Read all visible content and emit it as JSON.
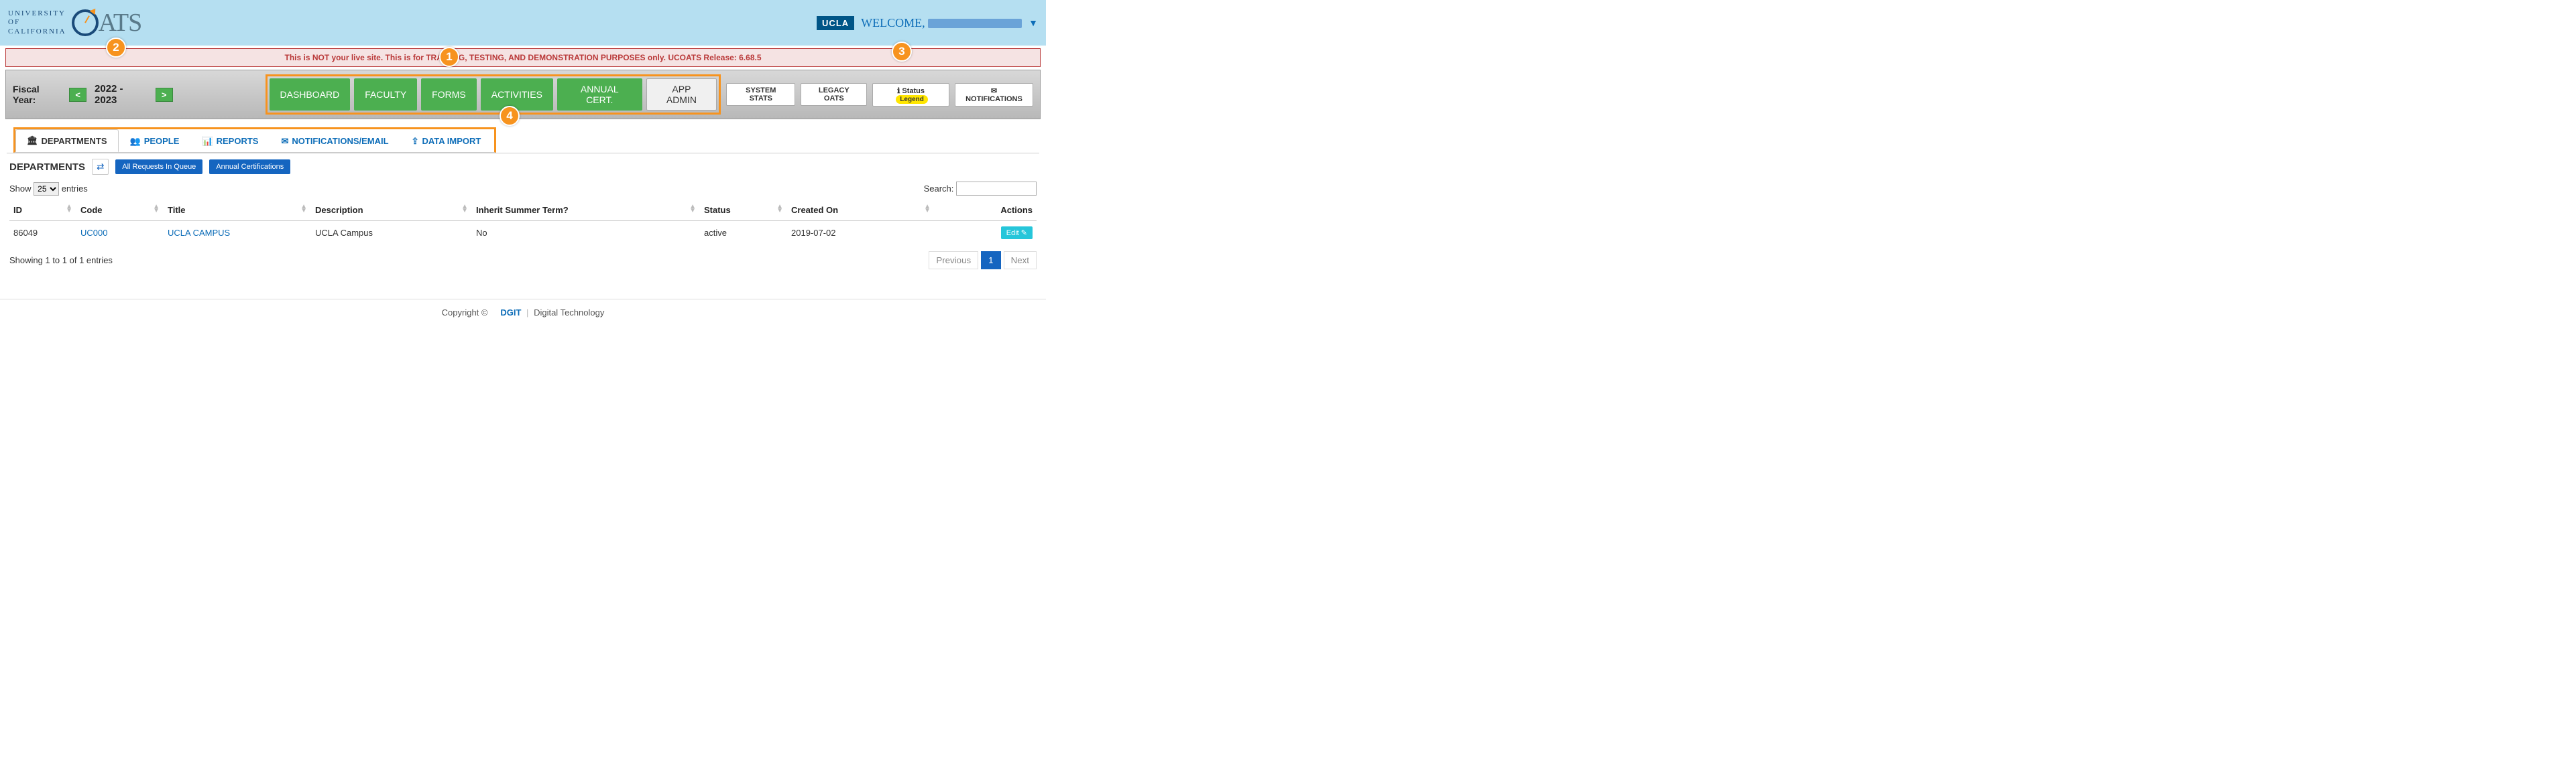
{
  "header": {
    "org_line1": "UNIVERSITY",
    "org_line2": "OF",
    "org_line3": "CALIFORNIA",
    "brand": "ATS",
    "campus_badge": "UCLA",
    "welcome": "WELCOME,",
    "alert": "This is NOT your live site. This is for TRAINING, TESTING, AND DEMONSTRATION PURPOSES only. UCOATS Release: 6.68.5"
  },
  "toolbar": {
    "fy_label": "Fiscal Year:",
    "fy_prev": "<",
    "fy_value": "2022 - 2023",
    "fy_next": ">",
    "nav": {
      "dashboard": "DASHBOARD",
      "faculty": "FACULTY",
      "forms": "FORMS",
      "activities": "ACTIVITIES",
      "annual_cert": "ANNUAL CERT.",
      "app_admin": "APP ADMIN"
    },
    "right": {
      "system_stats": "SYSTEM STATS",
      "legacy_oats": "LEGACY OATS",
      "status": "Status",
      "legend": "Legend",
      "notifications": "NOTIFICATIONS"
    }
  },
  "subnav": {
    "departments": "DEPARTMENTS",
    "people": "PEOPLE",
    "reports": "REPORTS",
    "notifications_email": "NOTIFICATIONS/EMAIL",
    "data_import": "DATA IMPORT"
  },
  "content": {
    "title": "DEPARTMENTS",
    "all_requests": "All Requests In Queue",
    "annual_certs": "Annual Certifications",
    "show_prefix": "Show",
    "show_value": "25",
    "show_suffix": "entries",
    "search_label": "Search:",
    "columns": {
      "id": "ID",
      "code": "Code",
      "title": "Title",
      "description": "Description",
      "inherit": "Inherit Summer Term?",
      "status": "Status",
      "created_on": "Created On",
      "actions": "Actions"
    },
    "rows": [
      {
        "id": "86049",
        "code": "UC000",
        "title": "UCLA CAMPUS",
        "description": "UCLA Campus",
        "inherit": "No",
        "status": "active",
        "created_on": "2019-07-02",
        "edit": "Edit"
      }
    ],
    "info": "Showing 1 to 1 of 1 entries",
    "prev": "Previous",
    "page": "1",
    "next": "Next"
  },
  "footer": {
    "copyright": "Copyright ©",
    "dgit": "DGIT",
    "digital_tech": "Digital Technology"
  },
  "annotations": {
    "a1": "1",
    "a2": "2",
    "a3": "3",
    "a4": "4"
  }
}
